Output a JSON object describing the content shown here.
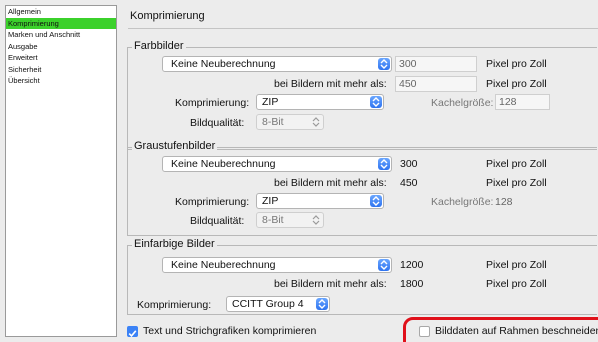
{
  "sidebar": {
    "items": [
      {
        "label": "Allgemein",
        "active": false
      },
      {
        "label": "Komprimierung",
        "active": true
      },
      {
        "label": "Marken und Anschnitt",
        "active": false
      },
      {
        "label": "Ausgabe",
        "active": false
      },
      {
        "label": "Erweitert",
        "active": false
      },
      {
        "label": "Sicherheit",
        "active": false
      },
      {
        "label": "Übersicht",
        "active": false
      }
    ]
  },
  "page_title": "Komprimierung",
  "farbbilder": {
    "title": "Farbbilder",
    "resample": "Keine Neuberechnung",
    "ppi": "300",
    "ppi_unit": "Pixel pro Zoll",
    "above_label": "bei Bildern mit mehr als:",
    "above_value": "450",
    "above_unit": "Pixel pro Zoll",
    "compression_label": "Komprimierung:",
    "compression": "ZIP",
    "tile_label": "Kachelgröße:",
    "tile_value": "128",
    "quality_label": "Bildqualität:",
    "quality": "8-Bit"
  },
  "graustufen": {
    "title": "Graustufenbilder",
    "resample": "Keine Neuberechnung",
    "ppi": "300",
    "ppi_unit": "Pixel pro Zoll",
    "above_label": "bei Bildern mit mehr als:",
    "above_value": "450",
    "above_unit": "Pixel pro Zoll",
    "compression_label": "Komprimierung:",
    "compression": "ZIP",
    "tile_label": "Kachelgröße:",
    "tile_value": "128",
    "quality_label": "Bildqualität:",
    "quality": "8-Bit"
  },
  "einfarbig": {
    "title": "Einfarbige Bilder",
    "resample": "Keine Neuberechnung",
    "ppi": "1200",
    "ppi_unit": "Pixel pro Zoll",
    "above_label": "bei Bildern mit mehr als:",
    "above_value": "1800",
    "above_unit": "Pixel pro Zoll",
    "compression_label": "Komprimierung:",
    "compression": "CCITT Group 4"
  },
  "options": {
    "compress_text_label": "Text und Strichgrafiken komprimieren",
    "compress_text_checked": true,
    "crop_label": "Bilddaten auf Rahmen beschneiden",
    "crop_checked": false
  },
  "colors": {
    "active_item": "#3bd12b",
    "accent": "#3b82f6",
    "highlight": "#e0101a"
  }
}
